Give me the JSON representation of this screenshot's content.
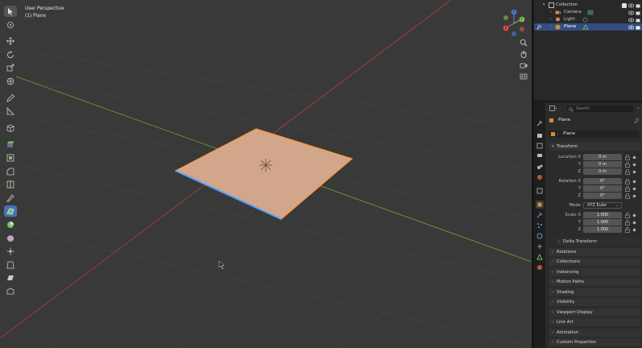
{
  "viewport": {
    "perspective_label": "User Perspective",
    "object_label": "(1) Plane",
    "gizmo_axes": [
      "Z",
      "Y",
      "X"
    ]
  },
  "toolbar": {
    "tools": [
      "select-box",
      "cursor",
      "move",
      "rotate",
      "scale",
      "transform",
      "annotate",
      "measure",
      "add-cube",
      "extrude-region",
      "inset-faces",
      "bevel",
      "loop-cut",
      "knife",
      "poly-build",
      "spin",
      "smooth",
      "edge-slide",
      "shrink-fatten",
      "shear",
      "rip-region"
    ],
    "active_tool": "poly-build"
  },
  "outliner": {
    "items": [
      {
        "label": "Collection",
        "type": "collection"
      },
      {
        "label": "Camera",
        "type": "camera"
      },
      {
        "label": "Light",
        "type": "light"
      },
      {
        "label": "Plane",
        "type": "mesh",
        "selected": true
      }
    ]
  },
  "properties": {
    "search_placeholder": "Search",
    "object_name": "Plane",
    "datablock_name": "Plane",
    "transform": {
      "title": "Transform",
      "location_label": "Location X",
      "rotation_label": "Rotation X",
      "scale_label": "Scale X",
      "y_label": "Y",
      "z_label": "Z",
      "location": [
        "0 m",
        "0 m",
        "0 m"
      ],
      "rotation": [
        "0°",
        "0°",
        "0°"
      ],
      "scale": [
        "1.000",
        "1.000",
        "1.000"
      ],
      "mode_label": "Mode",
      "mode_value": "XYZ Euler",
      "delta_title": "Delta Transform"
    },
    "panels": [
      "Relations",
      "Collections",
      "Instancing",
      "Motion Paths",
      "Shading",
      "Visibility",
      "Viewport Display",
      "Line Art",
      "Animation",
      "Custom Properties"
    ]
  },
  "colors": {
    "viewport_bg": "#393939",
    "plane_fill": "#d1a68b",
    "plane_outline": "#ff9a2e",
    "selected_edge": "#4fa1ff",
    "x_axis": "#b03a3a",
    "y_axis": "#6b9a2a",
    "active_tool": "#4772b3"
  }
}
